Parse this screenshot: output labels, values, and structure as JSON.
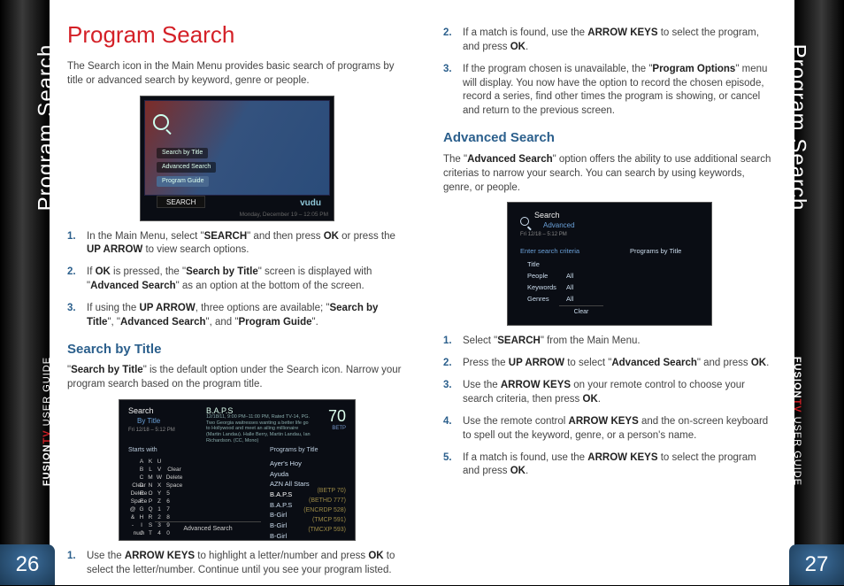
{
  "strip": {
    "title_left": "Program Search",
    "title_right": "Program Search",
    "brand1": "FUSION",
    "brand2": "TV",
    "guide": " USER GUIDE"
  },
  "pagenum": {
    "left": "26",
    "right": "27"
  },
  "left": {
    "h1": "Program Search",
    "intro": "The Search icon in the Main Menu provides basic search of programs by title or advanced search by keyword, genre or people.",
    "shot1": {
      "row1": "Search by Title",
      "row2": "Advanced Search",
      "row3": "Program Guide",
      "btn": "SEARCH",
      "vudu": "vudu",
      "cap": "Monday, December 19 – 12:05 PM"
    },
    "steps_a": [
      {
        "n": "1.",
        "pre": "In the Main Menu, select \"",
        "b1": "SEARCH",
        "mid": "\" and then press ",
        "b2": "OK",
        "mid2": " or press the ",
        "b3": "UP ARROW",
        "post": " to view search options."
      },
      {
        "n": "2.",
        "pre": "If ",
        "b1": "OK",
        "mid": " is pressed, the \"",
        "b2": "Search by Title",
        "mid2": "\" screen is displayed with \"",
        "b3": "Advanced Search",
        "post": "\" as an option at the bottom of the screen."
      },
      {
        "n": "3.",
        "pre": "If using the ",
        "b1": "UP ARROW",
        "mid": ", three options are available; \"",
        "b2": "Search by Title",
        "mid2": "\", \"",
        "b3": "Advanced Search",
        "mid3": "\", and \"",
        "b4": "Program Guide",
        "post": "\"."
      }
    ],
    "h2": "Search by Title",
    "sbt_intro_pre": "\"",
    "sbt_intro_b": "Search by Title",
    "sbt_intro_post": "\" is the default option under the Search icon. Narrow your program search based on the program title.",
    "shot2": {
      "hdr": "Search",
      "hdr2": "By Title",
      "time": "Fri 12/18 – 5:12 PM",
      "baps": "B.A.P.S",
      "desc": "12/18/11, 9:00 PM–11:00 PM, Rated TV-14, PG. Two Georgia waitresses wanting a better life go to Hollywood and meet an ailing millionaire (Martin Landau). Halle Berry, Martin Landau, Ian Richardson. (CC, Mono)",
      "ch": "70",
      "chl": "BETP",
      "starts": "Starts with",
      "kb_rows": [
        [
          "Clear",
          "Delete",
          "Space",
          "@",
          "&",
          "-",
          "num"
        ],
        [
          "A",
          "B",
          "C",
          "D",
          "E",
          "F",
          "G",
          "H",
          "I",
          "J"
        ],
        [
          "K",
          "L",
          "M",
          "N",
          "O",
          "P",
          "Q",
          "R",
          "S",
          "T"
        ],
        [
          "U",
          "V",
          "W",
          "X",
          "Y",
          "Z",
          "1",
          "2",
          "3",
          "4"
        ],
        [
          "Clear",
          "Delete",
          "Space",
          "5",
          "6",
          "7",
          "8",
          "9",
          "0"
        ]
      ],
      "adv": "Advanced Search",
      "pbt": "Programs by Title",
      "list": [
        "Ayer's Hoy",
        "Ayuda",
        "AZN All Stars",
        "B.A.P.S",
        "B.A.P.S",
        "B-Girl",
        "B-Girl",
        "B-Girl"
      ],
      "codes": [
        "(BETP 70)",
        "(BETHD 777)",
        "(ENCRDP 528)",
        "(TMCP 591)",
        "(TMCXP 593)"
      ]
    },
    "steps_b": [
      {
        "n": "1.",
        "pre": "Use the ",
        "b1": "ARROW KEYS",
        "mid": " to highlight a letter/number and press ",
        "b2": "OK",
        "post": " to select the letter/number. Continue until you see your program listed."
      }
    ]
  },
  "right": {
    "steps_top": [
      {
        "n": "2.",
        "pre": "If a match is found, use the ",
        "b1": "ARROW KEYS",
        "mid": " to select the program, and press ",
        "b2": "OK",
        "post": "."
      },
      {
        "n": "3.",
        "pre": "If the program chosen is unavailable, the \"",
        "b1": "Program Options",
        "post": "\" menu will display. You now have the option to record the chosen episode, record a series, find other times the program is showing, or cancel and return to the previous screen."
      }
    ],
    "h2": "Advanced Search",
    "adv_intro_pre": "The \"",
    "adv_intro_b": "Advanced Search",
    "adv_intro_post": "\" option offers the ability to use additional search criterias to narrow your search. You can search by using keywords, genre, or people.",
    "shot3": {
      "hdr": "Search",
      "hdr2": "Advanced",
      "time": "Fri 12/18 – 5:12 PM",
      "esc": "Enter search criteria",
      "rows": [
        [
          "Title",
          ""
        ],
        [
          "People",
          "All"
        ],
        [
          "Keywords",
          "All"
        ],
        [
          "Genres",
          "All"
        ]
      ],
      "clear": "Clear",
      "pbt": "Programs by Title"
    },
    "steps_bottom": [
      {
        "n": "1.",
        "pre": "Select \"",
        "b1": "SEARCH",
        "post": "\" from the Main Menu."
      },
      {
        "n": "2.",
        "pre": "Press the ",
        "b1": "UP ARROW",
        "mid": " to select \"",
        "b2": "Advanced Search",
        "mid2": "\" and press ",
        "b3": "OK",
        "post": "."
      },
      {
        "n": "3.",
        "pre": "Use the ",
        "b1": "ARROW KEYS",
        "mid": " on your remote control to choose your search criteria, then press ",
        "b2": "OK",
        "post": "."
      },
      {
        "n": "4.",
        "pre": "Use the remote control ",
        "b1": "ARROW KEYS",
        "post": " and the on-screen keyboard to spell out the keyword, genre, or a person's name."
      },
      {
        "n": "5.",
        "pre": "If a match is found, use the ",
        "b1": "ARROW KEYS",
        "mid": " to select the program and press ",
        "b2": "OK",
        "post": "."
      }
    ]
  }
}
